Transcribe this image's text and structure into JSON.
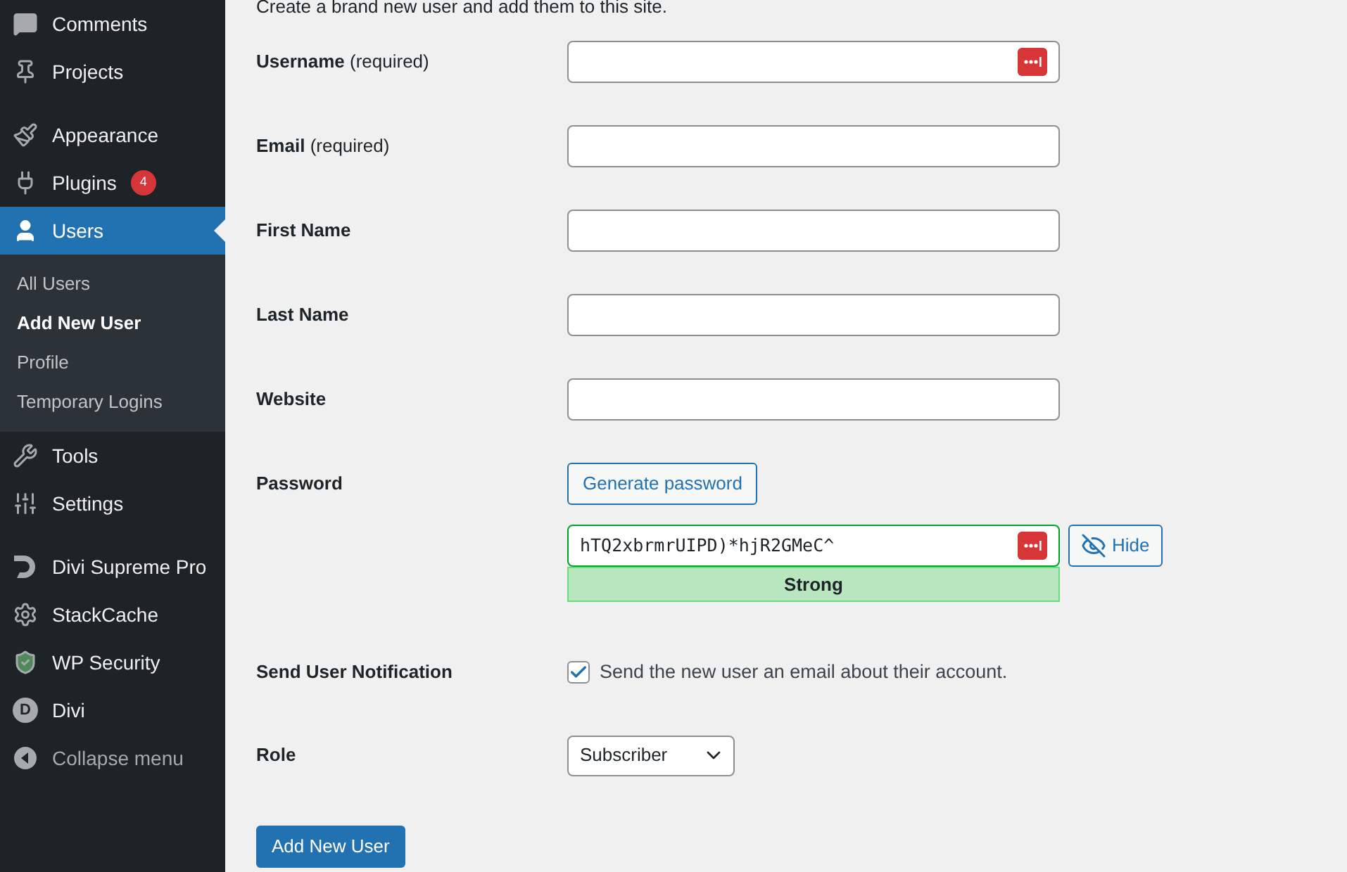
{
  "sidebar": {
    "items": [
      {
        "kind": "item",
        "label": "Comments",
        "selected": false
      },
      {
        "kind": "item",
        "label": "Projects",
        "selected": false
      },
      {
        "kind": "separator"
      },
      {
        "kind": "item",
        "label": "Appearance",
        "selected": false
      },
      {
        "kind": "item",
        "label": "Plugins",
        "selected": false,
        "badge": "4"
      },
      {
        "kind": "item",
        "label": "Users",
        "selected": true,
        "children": [
          {
            "label": "All Users",
            "selected": false
          },
          {
            "label": "Add New User",
            "selected": true
          },
          {
            "label": "Profile",
            "selected": false
          },
          {
            "label": "Temporary Logins",
            "selected": false
          }
        ]
      },
      {
        "kind": "item",
        "label": "Tools",
        "selected": false
      },
      {
        "kind": "item",
        "label": "Settings",
        "selected": false
      },
      {
        "kind": "separator"
      },
      {
        "kind": "item",
        "label": "Divi Supreme Pro",
        "selected": false
      },
      {
        "kind": "item",
        "label": "StackCache",
        "selected": false
      },
      {
        "kind": "item",
        "label": "WP Security",
        "selected": false
      },
      {
        "kind": "item",
        "label": "Divi",
        "selected": false,
        "icon_text": "D"
      },
      {
        "kind": "collapse",
        "label": "Collapse menu",
        "selected": false
      }
    ]
  },
  "intro": "Create a brand new user and add them to this site.",
  "fields": [
    {
      "label": "Username",
      "note": "(required)",
      "password_manager": true
    },
    {
      "label": "Email",
      "note": "(required)",
      "password_manager": false
    },
    {
      "label": "First Name",
      "password_manager": false
    },
    {
      "label": "Last Name",
      "password_manager": false
    },
    {
      "label": "Website",
      "password_manager": false
    }
  ],
  "password": {
    "label": "Password",
    "generate_button": "Generate password",
    "value": "hTQ2xbrmrUIPD)*hjR2GMeC^",
    "password_manager": true,
    "hide_button": "Hide",
    "strength": "Strong"
  },
  "notification": {
    "label": "Send User Notification",
    "checked": true,
    "text": "Send the new user an email about their account."
  },
  "role": {
    "label": "Role",
    "value": "Subscriber"
  },
  "submit": "Add New User"
}
